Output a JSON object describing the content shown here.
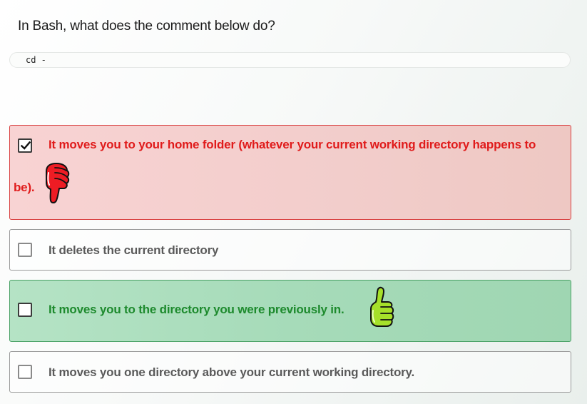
{
  "question": {
    "text": "In Bash, what does the comment below do?"
  },
  "code": {
    "text": "cd -"
  },
  "options": [
    {
      "text_line1": "It moves you to your home folder (whatever your current working directory happens to",
      "text_line2": "be).",
      "checked": true,
      "state": "wrong",
      "feedback_icon": "thumbs-down-icon"
    },
    {
      "text_line1": "It deletes the current directory",
      "checked": false,
      "state": "neutral"
    },
    {
      "text_line1": "It moves you to the directory you were previously in.",
      "checked": false,
      "state": "correct",
      "feedback_icon": "thumbs-up-icon"
    },
    {
      "text_line1": "It moves you one directory above your current working directory.",
      "checked": false,
      "state": "neutral"
    }
  ],
  "colors": {
    "wrong_text": "#e01b1b",
    "wrong_bg": "#f5d0cf",
    "correct_text": "#1d8a2d",
    "correct_bg": "#a8dcba",
    "neutral_text": "#5a5a5a"
  }
}
